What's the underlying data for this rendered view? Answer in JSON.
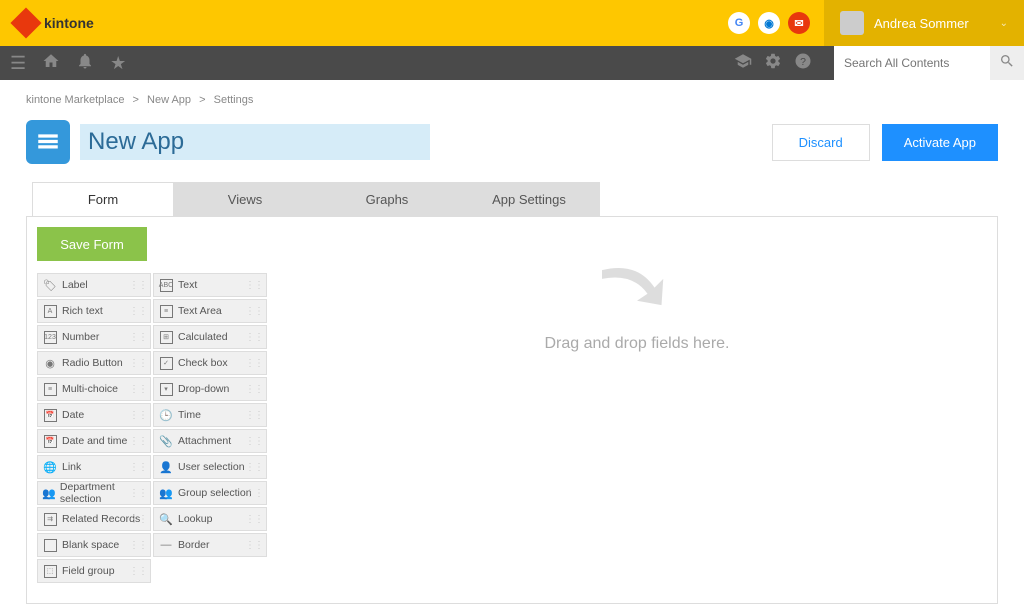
{
  "brand": "kintone",
  "user": {
    "name": "Andrea Sommer"
  },
  "search": {
    "placeholder": "Search All Contents"
  },
  "breadcrumb": {
    "a": "kintone Marketplace",
    "b": "New App",
    "c": "Settings"
  },
  "app": {
    "title": "New App"
  },
  "buttons": {
    "discard": "Discard",
    "activate": "Activate App",
    "save_form": "Save Form"
  },
  "tabs": {
    "form": "Form",
    "views": "Views",
    "graphs": "Graphs",
    "app_settings": "App Settings"
  },
  "drop": {
    "hint": "Drag and drop fields here."
  },
  "fields": {
    "label": "Label",
    "text": "Text",
    "rich_text": "Rich text",
    "text_area": "Text Area",
    "number": "Number",
    "calculated": "Calculated",
    "radio": "Radio Button",
    "checkbox": "Check box",
    "multichoice": "Multi-choice",
    "dropdown": "Drop-down",
    "date": "Date",
    "time": "Time",
    "datetime": "Date and time",
    "attachment": "Attachment",
    "link": "Link",
    "user_sel": "User selection",
    "dept_sel": "Department selection",
    "group_sel": "Group selection",
    "related": "Related Records",
    "lookup": "Lookup",
    "blank": "Blank space",
    "border": "Border",
    "field_group": "Field group"
  }
}
